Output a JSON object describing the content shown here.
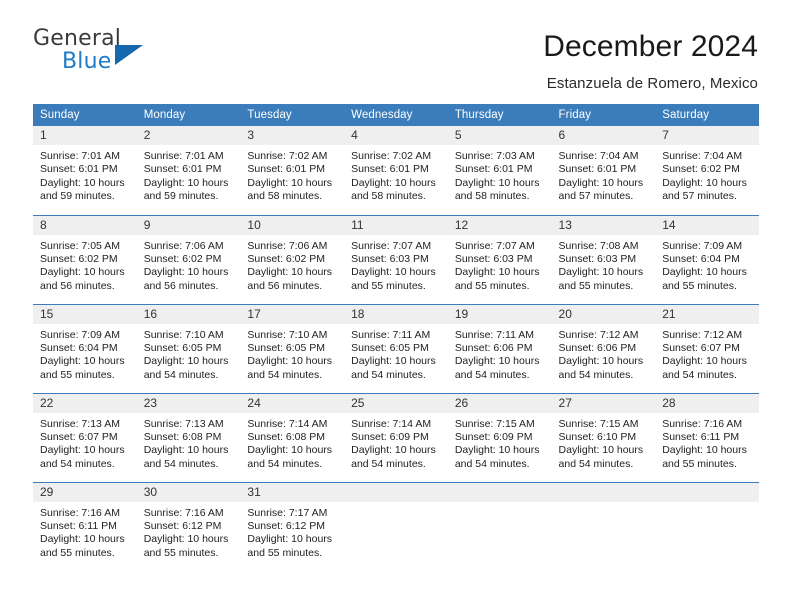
{
  "logo": {
    "word_top": "General",
    "word_bottom": "Blue",
    "accent_color": "#1668ad",
    "text_color": "#3b3b3b",
    "blue_text_color": "#1e7bc8"
  },
  "header": {
    "title": "December 2024",
    "subtitle": "Estanzuela de Romero, Mexico"
  },
  "theme": {
    "header_blue": "#3a7dba",
    "daynum_gray": "#efefef"
  },
  "weekdays": [
    "Sunday",
    "Monday",
    "Tuesday",
    "Wednesday",
    "Thursday",
    "Friday",
    "Saturday"
  ],
  "weeks": [
    [
      {
        "day": "1",
        "sunrise": "Sunrise: 7:01 AM",
        "sunset": "Sunset: 6:01 PM",
        "daylight_line1": "Daylight: 10 hours",
        "daylight_line2": "and 59 minutes."
      },
      {
        "day": "2",
        "sunrise": "Sunrise: 7:01 AM",
        "sunset": "Sunset: 6:01 PM",
        "daylight_line1": "Daylight: 10 hours",
        "daylight_line2": "and 59 minutes."
      },
      {
        "day": "3",
        "sunrise": "Sunrise: 7:02 AM",
        "sunset": "Sunset: 6:01 PM",
        "daylight_line1": "Daylight: 10 hours",
        "daylight_line2": "and 58 minutes."
      },
      {
        "day": "4",
        "sunrise": "Sunrise: 7:02 AM",
        "sunset": "Sunset: 6:01 PM",
        "daylight_line1": "Daylight: 10 hours",
        "daylight_line2": "and 58 minutes."
      },
      {
        "day": "5",
        "sunrise": "Sunrise: 7:03 AM",
        "sunset": "Sunset: 6:01 PM",
        "daylight_line1": "Daylight: 10 hours",
        "daylight_line2": "and 58 minutes."
      },
      {
        "day": "6",
        "sunrise": "Sunrise: 7:04 AM",
        "sunset": "Sunset: 6:01 PM",
        "daylight_line1": "Daylight: 10 hours",
        "daylight_line2": "and 57 minutes."
      },
      {
        "day": "7",
        "sunrise": "Sunrise: 7:04 AM",
        "sunset": "Sunset: 6:02 PM",
        "daylight_line1": "Daylight: 10 hours",
        "daylight_line2": "and 57 minutes."
      }
    ],
    [
      {
        "day": "8",
        "sunrise": "Sunrise: 7:05 AM",
        "sunset": "Sunset: 6:02 PM",
        "daylight_line1": "Daylight: 10 hours",
        "daylight_line2": "and 56 minutes."
      },
      {
        "day": "9",
        "sunrise": "Sunrise: 7:06 AM",
        "sunset": "Sunset: 6:02 PM",
        "daylight_line1": "Daylight: 10 hours",
        "daylight_line2": "and 56 minutes."
      },
      {
        "day": "10",
        "sunrise": "Sunrise: 7:06 AM",
        "sunset": "Sunset: 6:02 PM",
        "daylight_line1": "Daylight: 10 hours",
        "daylight_line2": "and 56 minutes."
      },
      {
        "day": "11",
        "sunrise": "Sunrise: 7:07 AM",
        "sunset": "Sunset: 6:03 PM",
        "daylight_line1": "Daylight: 10 hours",
        "daylight_line2": "and 55 minutes."
      },
      {
        "day": "12",
        "sunrise": "Sunrise: 7:07 AM",
        "sunset": "Sunset: 6:03 PM",
        "daylight_line1": "Daylight: 10 hours",
        "daylight_line2": "and 55 minutes."
      },
      {
        "day": "13",
        "sunrise": "Sunrise: 7:08 AM",
        "sunset": "Sunset: 6:03 PM",
        "daylight_line1": "Daylight: 10 hours",
        "daylight_line2": "and 55 minutes."
      },
      {
        "day": "14",
        "sunrise": "Sunrise: 7:09 AM",
        "sunset": "Sunset: 6:04 PM",
        "daylight_line1": "Daylight: 10 hours",
        "daylight_line2": "and 55 minutes."
      }
    ],
    [
      {
        "day": "15",
        "sunrise": "Sunrise: 7:09 AM",
        "sunset": "Sunset: 6:04 PM",
        "daylight_line1": "Daylight: 10 hours",
        "daylight_line2": "and 55 minutes."
      },
      {
        "day": "16",
        "sunrise": "Sunrise: 7:10 AM",
        "sunset": "Sunset: 6:05 PM",
        "daylight_line1": "Daylight: 10 hours",
        "daylight_line2": "and 54 minutes."
      },
      {
        "day": "17",
        "sunrise": "Sunrise: 7:10 AM",
        "sunset": "Sunset: 6:05 PM",
        "daylight_line1": "Daylight: 10 hours",
        "daylight_line2": "and 54 minutes."
      },
      {
        "day": "18",
        "sunrise": "Sunrise: 7:11 AM",
        "sunset": "Sunset: 6:05 PM",
        "daylight_line1": "Daylight: 10 hours",
        "daylight_line2": "and 54 minutes."
      },
      {
        "day": "19",
        "sunrise": "Sunrise: 7:11 AM",
        "sunset": "Sunset: 6:06 PM",
        "daylight_line1": "Daylight: 10 hours",
        "daylight_line2": "and 54 minutes."
      },
      {
        "day": "20",
        "sunrise": "Sunrise: 7:12 AM",
        "sunset": "Sunset: 6:06 PM",
        "daylight_line1": "Daylight: 10 hours",
        "daylight_line2": "and 54 minutes."
      },
      {
        "day": "21",
        "sunrise": "Sunrise: 7:12 AM",
        "sunset": "Sunset: 6:07 PM",
        "daylight_line1": "Daylight: 10 hours",
        "daylight_line2": "and 54 minutes."
      }
    ],
    [
      {
        "day": "22",
        "sunrise": "Sunrise: 7:13 AM",
        "sunset": "Sunset: 6:07 PM",
        "daylight_line1": "Daylight: 10 hours",
        "daylight_line2": "and 54 minutes."
      },
      {
        "day": "23",
        "sunrise": "Sunrise: 7:13 AM",
        "sunset": "Sunset: 6:08 PM",
        "daylight_line1": "Daylight: 10 hours",
        "daylight_line2": "and 54 minutes."
      },
      {
        "day": "24",
        "sunrise": "Sunrise: 7:14 AM",
        "sunset": "Sunset: 6:08 PM",
        "daylight_line1": "Daylight: 10 hours",
        "daylight_line2": "and 54 minutes."
      },
      {
        "day": "25",
        "sunrise": "Sunrise: 7:14 AM",
        "sunset": "Sunset: 6:09 PM",
        "daylight_line1": "Daylight: 10 hours",
        "daylight_line2": "and 54 minutes."
      },
      {
        "day": "26",
        "sunrise": "Sunrise: 7:15 AM",
        "sunset": "Sunset: 6:09 PM",
        "daylight_line1": "Daylight: 10 hours",
        "daylight_line2": "and 54 minutes."
      },
      {
        "day": "27",
        "sunrise": "Sunrise: 7:15 AM",
        "sunset": "Sunset: 6:10 PM",
        "daylight_line1": "Daylight: 10 hours",
        "daylight_line2": "and 54 minutes."
      },
      {
        "day": "28",
        "sunrise": "Sunrise: 7:16 AM",
        "sunset": "Sunset: 6:11 PM",
        "daylight_line1": "Daylight: 10 hours",
        "daylight_line2": "and 55 minutes."
      }
    ],
    [
      {
        "day": "29",
        "sunrise": "Sunrise: 7:16 AM",
        "sunset": "Sunset: 6:11 PM",
        "daylight_line1": "Daylight: 10 hours",
        "daylight_line2": "and 55 minutes."
      },
      {
        "day": "30",
        "sunrise": "Sunrise: 7:16 AM",
        "sunset": "Sunset: 6:12 PM",
        "daylight_line1": "Daylight: 10 hours",
        "daylight_line2": "and 55 minutes."
      },
      {
        "day": "31",
        "sunrise": "Sunrise: 7:17 AM",
        "sunset": "Sunset: 6:12 PM",
        "daylight_line1": "Daylight: 10 hours",
        "daylight_line2": "and 55 minutes."
      },
      {
        "day": "",
        "sunrise": "",
        "sunset": "",
        "daylight_line1": "",
        "daylight_line2": ""
      },
      {
        "day": "",
        "sunrise": "",
        "sunset": "",
        "daylight_line1": "",
        "daylight_line2": ""
      },
      {
        "day": "",
        "sunrise": "",
        "sunset": "",
        "daylight_line1": "",
        "daylight_line2": ""
      },
      {
        "day": "",
        "sunrise": "",
        "sunset": "",
        "daylight_line1": "",
        "daylight_line2": ""
      }
    ]
  ]
}
